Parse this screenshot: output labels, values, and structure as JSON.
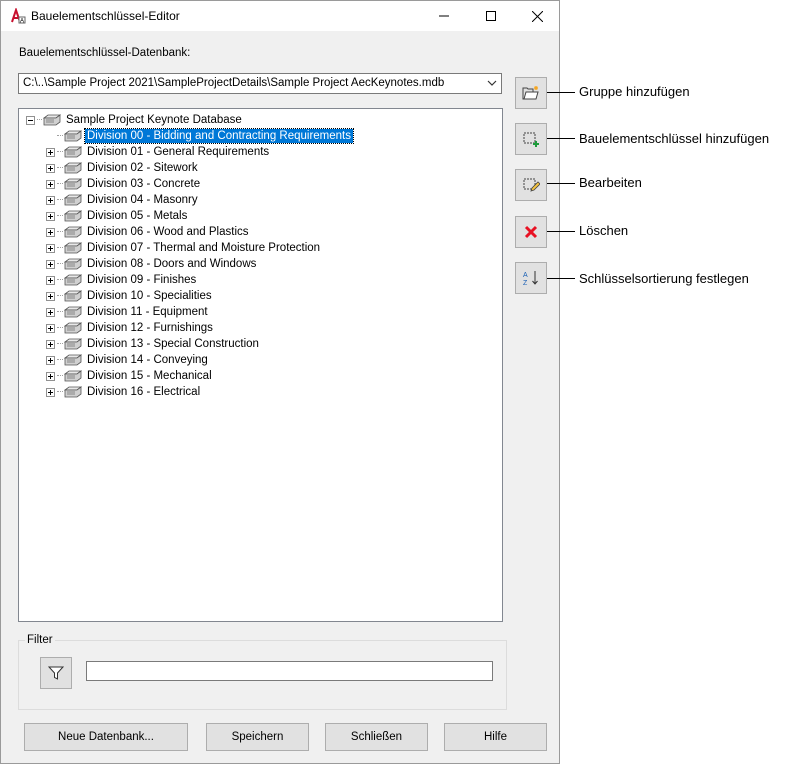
{
  "window": {
    "title": "Bauelementschlüssel-Editor"
  },
  "titlebar": {
    "icons": [
      "autocad-app-icon",
      "minimize-icon",
      "maximize-icon",
      "close-icon"
    ]
  },
  "database": {
    "label": "Bauelementschlüssel-Datenbank:",
    "path": "C:\\..\\Sample Project 2021\\SampleProjectDetails\\Sample Project AecKeynotes.mdb"
  },
  "tree": {
    "root": "Sample Project Keynote Database",
    "items": [
      {
        "label": "Division 00 - Bidding and Contracting Requirements",
        "selected": true,
        "expandable": false
      },
      {
        "label": "Division 01 - General Requirements",
        "expandable": true
      },
      {
        "label": "Division 02 - Sitework",
        "expandable": true
      },
      {
        "label": "Division 03 - Concrete",
        "expandable": true
      },
      {
        "label": "Division 04 - Masonry",
        "expandable": true
      },
      {
        "label": "Division 05 - Metals",
        "expandable": true
      },
      {
        "label": "Division 06 - Wood and Plastics",
        "expandable": true
      },
      {
        "label": "Division 07 - Thermal and Moisture Protection",
        "expandable": true
      },
      {
        "label": "Division 08 - Doors and Windows",
        "expandable": true
      },
      {
        "label": "Division 09 - Finishes",
        "expandable": true
      },
      {
        "label": "Division 10 - Specialities",
        "expandable": true
      },
      {
        "label": "Division 11 - Equipment",
        "expandable": true
      },
      {
        "label": "Division 12 - Furnishings",
        "expandable": true
      },
      {
        "label": "Division 13 - Special Construction",
        "expandable": true
      },
      {
        "label": "Division 14 - Conveying",
        "expandable": true
      },
      {
        "label": "Division 15 - Mechanical",
        "expandable": true
      },
      {
        "label": "Division 16 - Electrical",
        "expandable": true
      }
    ]
  },
  "side_buttons": [
    {
      "icon": "add-group-folder-icon",
      "callout": "Gruppe hinzufügen"
    },
    {
      "icon": "add-keynote-icon",
      "callout": "Bauelementschlüssel hinzufügen"
    },
    {
      "icon": "edit-icon",
      "callout": "Bearbeiten"
    },
    {
      "icon": "delete-x-icon",
      "callout": "Löschen"
    },
    {
      "icon": "sort-az-icon",
      "callout": "Schlüsselsortierung festlegen"
    }
  ],
  "filter": {
    "label": "Filter",
    "value": "",
    "icon": "funnel-icon"
  },
  "buttons": {
    "new_db": "Neue Datenbank...",
    "save": "Speichern",
    "close": "Schließen",
    "help": "Hilfe"
  },
  "colors": {
    "selection": "#0078d7",
    "delete_red": "#e81123",
    "add_green": "#1e9b3c"
  }
}
